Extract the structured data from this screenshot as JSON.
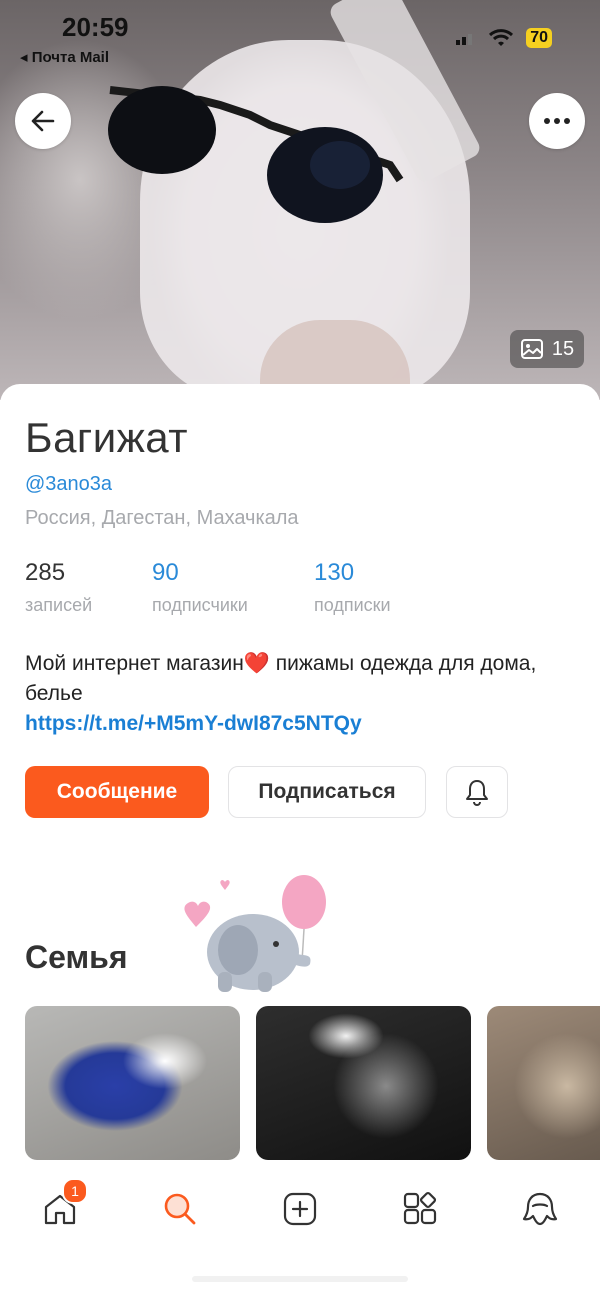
{
  "status_bar": {
    "time": "20:59",
    "back_app": "◂ Почта Mail",
    "battery": "70"
  },
  "cover": {
    "photo_count": "15"
  },
  "profile": {
    "name": "Багижат",
    "username": "@3ano3a",
    "location": "Россия, Дагестан, Махачкала",
    "stats": [
      {
        "value": "285",
        "label": "записей"
      },
      {
        "value": "90",
        "label": "подписчики"
      },
      {
        "value": "130",
        "label": "подписки"
      }
    ],
    "bio_line": "Мой интернет магазин❤️ пижамы одежда для дома, белье",
    "bio_link": "https://t.me/+M5mY-dwI87c5NTQy"
  },
  "actions": {
    "message_label": "Сообщение",
    "subscribe_label": "Подписаться"
  },
  "albums_section": {
    "title": "Семья"
  },
  "tabbar": {
    "home_badge": "1"
  },
  "colors": {
    "accent": "#fb5a1e",
    "link": "#2a8ad8",
    "muted": "#a7a9ad"
  },
  "icons": [
    "back-arrow-icon",
    "more-icon",
    "wifi-icon",
    "signal-icon",
    "gallery-icon",
    "bell-icon",
    "home-icon",
    "search-icon",
    "add-icon",
    "services-icon",
    "profile-icon"
  ]
}
